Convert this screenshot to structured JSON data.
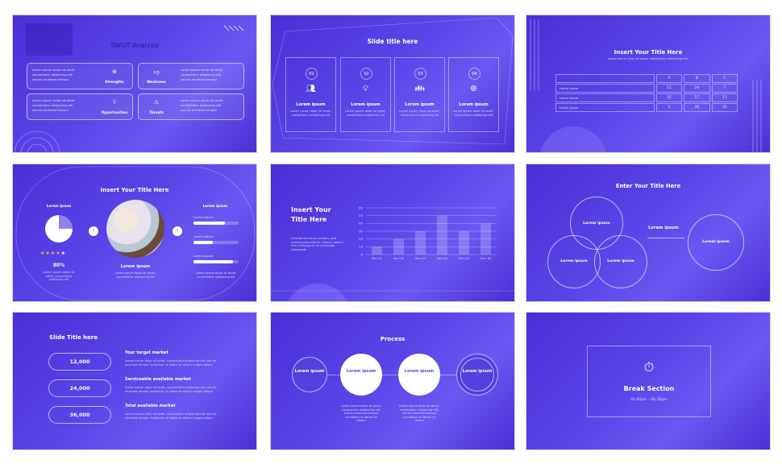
{
  "colors": {
    "background": "#5a44e8",
    "accent": "#ffffff",
    "star": "#f5b942"
  },
  "slides": {
    "swot": {
      "title": "SWOT Analysis",
      "bullets": [
        "Lorem ipsum dolor sit amet consectetur adipiscing elit",
        "sed do eiusmod tempor"
      ],
      "quadrants": [
        {
          "label": "Strengths",
          "icon": "globe-icon"
        },
        {
          "label": "Weakness",
          "icon": "thumbs-down-icon"
        },
        {
          "label": "Opportunities",
          "icon": "lightbulb-icon"
        },
        {
          "label": "Threats",
          "icon": "warning-icon"
        }
      ]
    },
    "steps": {
      "title": "Slide title here",
      "cards": [
        {
          "num": "01",
          "icon": "team-network-icon",
          "title": "Lorem ipsum",
          "text": "Lorem ipsum dolor sit amet, consectetur adipiscing elit"
        },
        {
          "num": "02",
          "icon": "idea-people-icon",
          "title": "Lorem ipsum",
          "text": "Lorem ipsum dolor sit amet, consectetur adipiscing elit"
        },
        {
          "num": "03",
          "icon": "group-icon",
          "title": "Lorem ipsum",
          "text": "Lorem ipsum dolor sit amet, consectetur adipiscing elit"
        },
        {
          "num": "04",
          "icon": "globe-icon",
          "title": "Lorem ipsum",
          "text": "Lorem ipsum dolor sit amet, consectetur adipiscing elit"
        }
      ]
    },
    "table": {
      "title": "Insert Your Title Here",
      "subtitle": "Lorem ipsum dolor sit amet, consectetur adipiscing elit.",
      "headers": [
        "",
        "A",
        "B",
        "C"
      ],
      "rows": [
        [
          "Lorem ipsum",
          "11",
          "24",
          "7"
        ],
        [
          "Lorem ipsum",
          "32",
          "17",
          "13"
        ],
        [
          "Lorem ipsum",
          "5",
          "36",
          "26"
        ]
      ]
    },
    "stats": {
      "title": "Insert Your Title Here",
      "left_heading": "Lorem ipsum",
      "pie_percent": 75,
      "rating": 4,
      "rating_max": 5,
      "percent": "80%",
      "left_text": "Lorem ipsum dolor sit amet, consectetur adipiscing elit",
      "center_title": "Lorem ipsum",
      "center_text": "Lorem ipsum dolor sit amet, consectetur adipiscing elit",
      "right_heading": "Lorem ipsum",
      "bars": [
        {
          "label": "Lorem ipsum",
          "value": 70
        },
        {
          "label": "Lorem ipsum",
          "value": 43
        },
        {
          "label": "Lorem ipsum",
          "value": 88
        }
      ],
      "right_text": "Lorem ipsum dolor sit amet, consectetur adipiscing elit"
    },
    "chart": {
      "title": "Insert Your Title Here",
      "text": "Ut enim ad minim veniam, quis nostrud exercitation ullamco laboris nisi ut aliquip ex ea commodo consequat."
    },
    "venn": {
      "title": "Enter Your Title Here",
      "circles": [
        "Lorem ipsum",
        "Lorem ipsum",
        "Lorem ipsum"
      ],
      "arrow_label": "Lorem ipsum",
      "result": "Lorem ipsum"
    },
    "market": {
      "title": "Slide Title here",
      "items": [
        {
          "value": "12,000",
          "heading": "Your target market",
          "text": "Lorem ipsum dolor sit amet, consectetur adipiscing elit, sed do eiusmod tempor incididunt ut labore et dolore magna aliqua."
        },
        {
          "value": "24,000",
          "heading": "Serviceable available market",
          "text": "Lorem ipsum dolor sit amet, consectetur adipiscing elit, sed do eiusmod tempor incididunt ut labore et dolore magna aliqua."
        },
        {
          "value": "36,000",
          "heading": "Total available market",
          "text": "Lorem ipsum dolor sit amet, consectetur adipiscing elit, sed do eiusmod tempor incididunt ut labore et dolore magna aliqua."
        }
      ]
    },
    "process": {
      "title": "Process",
      "steps": [
        "Lorem ipsum",
        "Lorem ipsum",
        "Lorem ipsum",
        "Lorem ipsum"
      ],
      "text": "Lorem ipsum dolor sit amet, consectetur adipiscing elit, sed do eiusmod tempor incididunt ut labore et dolore"
    },
    "break": {
      "title": "Break Section",
      "time": "01:00pm – 01:30pm",
      "icon": "stopwatch-icon"
    }
  },
  "chart_data": {
    "type": "bar",
    "categories": [
      "Item 01",
      "Item 02",
      "Item 03",
      "Item 04",
      "Item 05",
      "Item 06"
    ],
    "values": [
      10,
      20,
      30,
      50,
      30,
      40
    ],
    "ylim": [
      0,
      60
    ],
    "yticks": [
      0,
      10,
      20,
      30,
      40,
      50,
      60
    ],
    "grid": true,
    "title": "",
    "xlabel": "",
    "ylabel": ""
  }
}
